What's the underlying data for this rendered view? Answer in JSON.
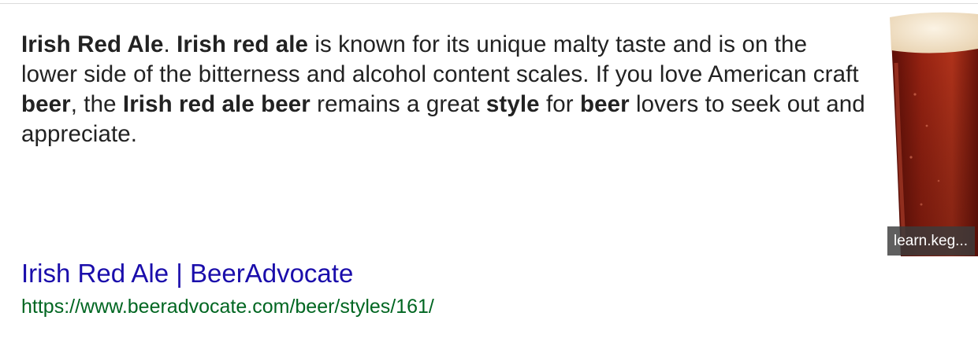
{
  "snippet": {
    "runs": [
      {
        "text": "Irish Red Ale",
        "bold": true
      },
      {
        "text": ". ",
        "bold": false
      },
      {
        "text": "Irish red ale",
        "bold": true
      },
      {
        "text": " is known for its unique malty taste and is on the lower side of the bitterness and alcohol content scales. If you love American craft ",
        "bold": false
      },
      {
        "text": "beer",
        "bold": true
      },
      {
        "text": ", the ",
        "bold": false
      },
      {
        "text": "Irish red ale beer",
        "bold": true
      },
      {
        "text": " remains a great ",
        "bold": false
      },
      {
        "text": "style",
        "bold": true
      },
      {
        "text": " for ",
        "bold": false
      },
      {
        "text": "beer",
        "bold": true
      },
      {
        "text": " lovers to seek out and appreciate.",
        "bold": false
      }
    ]
  },
  "image": {
    "icon": "beer-glass-image",
    "source_label": "learn.keg..."
  },
  "result": {
    "title": "Irish Red Ale | BeerAdvocate",
    "url": "https://www.beeradvocate.com/beer/styles/161/"
  },
  "colors": {
    "link": "#1a0dab",
    "url": "#006621",
    "text": "#222222",
    "beer": "#8e1a10",
    "foam": "#f3e4cc"
  }
}
